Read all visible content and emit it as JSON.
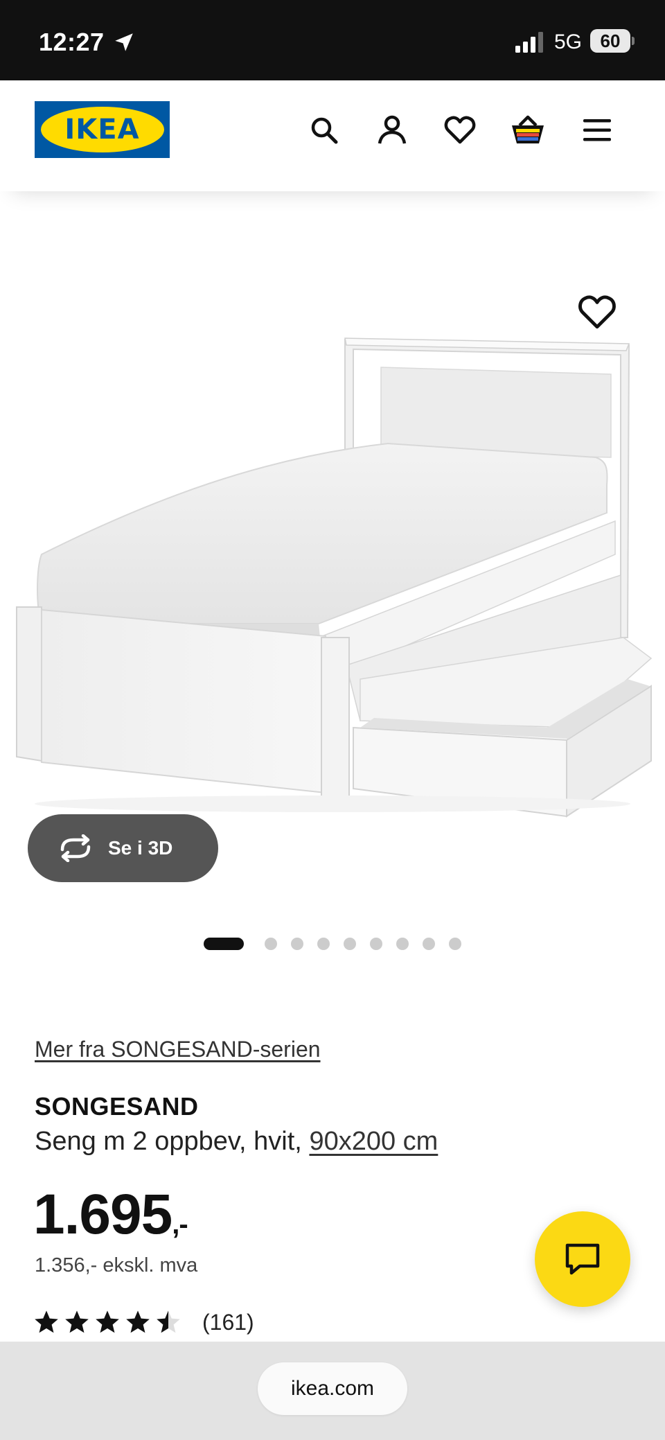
{
  "status_bar": {
    "time": "12:27",
    "network": "5G",
    "battery": "60"
  },
  "header": {
    "logo_text": "IKEA",
    "icons": [
      "search-icon",
      "account-icon",
      "heart-icon",
      "basket-icon",
      "menu-icon"
    ]
  },
  "gallery": {
    "view_3d_label": "Se i 3D",
    "dot_count": 9,
    "active_index": 0
  },
  "product": {
    "series_link": "Mer fra SONGESAND-serien",
    "name": "SONGESAND",
    "description": "Seng m 2 oppbev, hvit,",
    "size_link": "90x200 cm",
    "price_main": "1.695",
    "price_suffix": ",-",
    "price_ex_vat": "1.356,- ekskl. mva",
    "rating_value": 4.5,
    "rating_count": "(161)"
  },
  "browser": {
    "url": "ikea.com"
  },
  "colors": {
    "ikea_blue": "#0058a3",
    "ikea_yellow": "#ffdb00",
    "chat_yellow": "#fbd914"
  }
}
